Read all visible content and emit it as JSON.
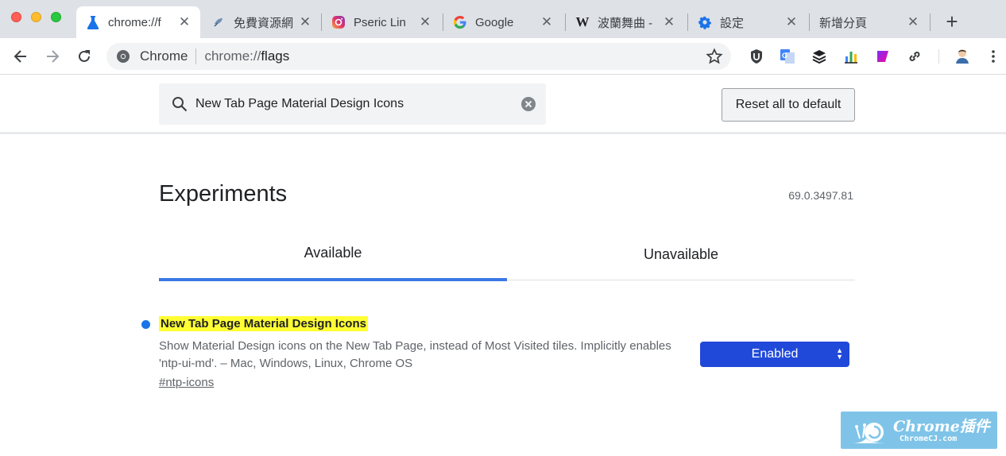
{
  "window": {
    "tabs": [
      {
        "title": "chrome://f",
        "favicon": "flask-icon",
        "active": true
      },
      {
        "title": "免費資源網",
        "favicon": "page-icon",
        "active": false
      },
      {
        "title": "Pseric Lin",
        "favicon": "instagram-icon",
        "active": false
      },
      {
        "title": "Google",
        "favicon": "google-icon",
        "active": false
      },
      {
        "title": "波蘭舞曲 -",
        "favicon": "wikipedia-icon",
        "active": false
      },
      {
        "title": "設定",
        "favicon": "gear-icon",
        "active": false
      },
      {
        "title": "新增分頁",
        "favicon": "",
        "active": false
      }
    ],
    "close_glyph": "✕",
    "new_tab_glyph": "+"
  },
  "toolbar": {
    "chip_label": "Chrome",
    "url_prefix": "chrome://",
    "url_path": "flags",
    "extensions": [
      "ublock-icon",
      "translate-icon",
      "layers-icon",
      "chart-icon",
      "gradient-icon",
      "link-icon"
    ],
    "profile": "avatar"
  },
  "flags": {
    "search_value": "New Tab Page Material Design Icons",
    "reset_label": "Reset all to default",
    "title": "Experiments",
    "version": "69.0.3497.81",
    "tab_available": "Available",
    "tab_unavailable": "Unavailable",
    "experiment": {
      "name": "New Tab Page Material Design Icons",
      "description": "Show Material Design icons on the New Tab Page, instead of Most Visited tiles. Implicitly enables 'ntp-ui-md'. – Mac, Windows, Linux, Chrome OS",
      "link": "#ntp-icons",
      "state": "Enabled"
    }
  },
  "watermark": {
    "title": "Chrome插件",
    "subtitle": "ChromeCJ.com"
  },
  "colors": {
    "accent": "#3b78e7",
    "select_bg": "#2149d9",
    "highlight": "#ffff33"
  }
}
